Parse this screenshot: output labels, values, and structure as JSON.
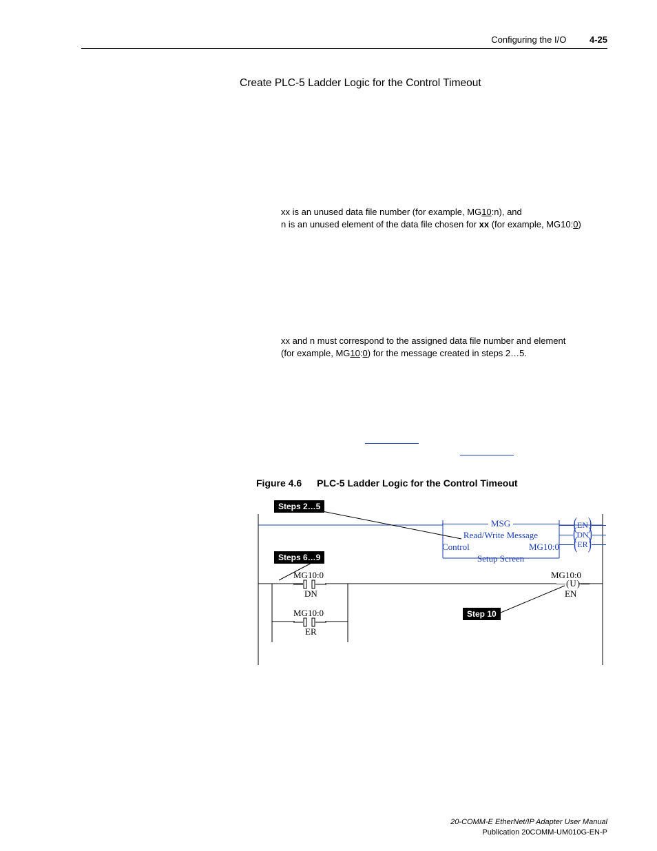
{
  "header": {
    "section": "Configuring the I/O",
    "page": "4-25"
  },
  "heading": "Create PLC-5 Ladder Logic for the Control Timeout",
  "para1": {
    "xx_prefix": "xx is an unused data file number (for example, MG",
    "xx_underlined": "10",
    "xx_suffix": ":n), and",
    "n_prefix": "n is an unused element of the data file chosen for ",
    "n_bold": "xx",
    "n_mid": " (for example, MG10:",
    "n_underlined": "0",
    "n_suffix": ")"
  },
  "para2": {
    "line1": "xx and n must correspond to the assigned data file number and element",
    "line2_prefix": "(for example, MG",
    "line2_u1": "10",
    "line2_mid": ":",
    "line2_u2": "0",
    "line2_suffix": ") for the message created in steps 2…5."
  },
  "figure": {
    "num": "Figure 4.6",
    "title": "PLC-5 Ladder Logic for the Control Timeout"
  },
  "diagram": {
    "step25": "Steps 2…5",
    "step69": "Steps 6…9",
    "step10": "Step 10",
    "msg": {
      "title": "MSG",
      "desc": "Read/Write Message",
      "control_label": "Control",
      "control_value": "MG10:0",
      "setup": "Setup Screen"
    },
    "tails": {
      "en": "EN",
      "dn": "DN",
      "er": "ER"
    },
    "rung2": {
      "addr1": "MG10:0",
      "dn": "DN",
      "addr2": "MG10:0",
      "er": "ER",
      "out_addr": "MG10:0",
      "out_u": "U",
      "out_en": "EN"
    }
  },
  "footer": {
    "title": "20-COMM-E EtherNet/IP Adapter User Manual",
    "pub": "Publication 20COMM-UM010G-EN-P"
  }
}
